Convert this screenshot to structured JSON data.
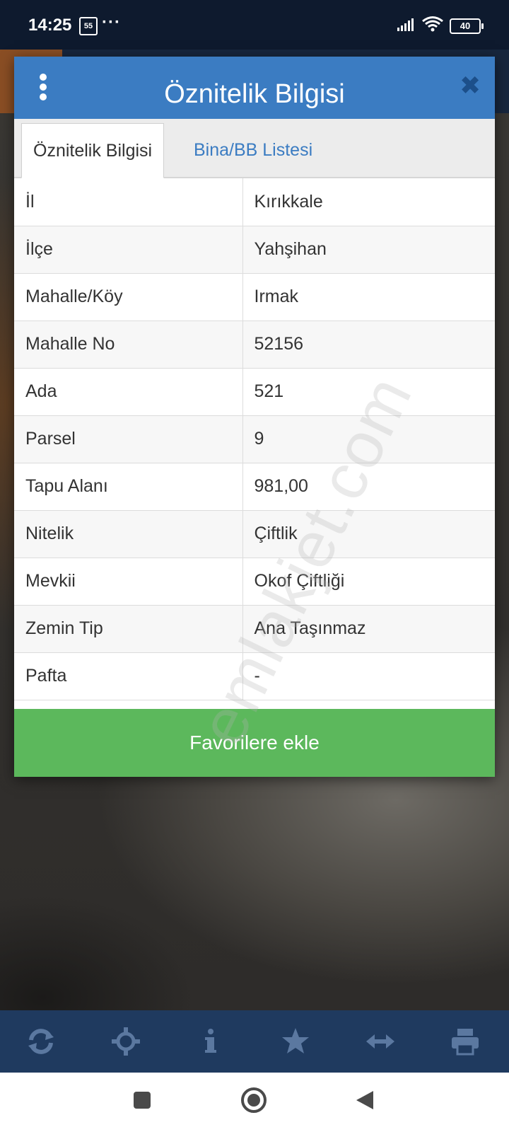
{
  "status_bar": {
    "time": "14:25",
    "notification_badge": "55",
    "more": "···",
    "battery": "40"
  },
  "dialog": {
    "title": "Öznitelik Bilgisi",
    "tabs": [
      {
        "label": "Öznitelik Bilgisi",
        "active": true
      },
      {
        "label": "Bina/BB Listesi",
        "active": false
      }
    ],
    "rows": [
      {
        "key": "İl",
        "value": "Kırıkkale"
      },
      {
        "key": "İlçe",
        "value": "Yahşihan"
      },
      {
        "key": "Mahalle/Köy",
        "value": "Irmak"
      },
      {
        "key": "Mahalle No",
        "value": "52156"
      },
      {
        "key": "Ada",
        "value": "521"
      },
      {
        "key": "Parsel",
        "value": "9"
      },
      {
        "key": "Tapu Alanı",
        "value": "981,00"
      },
      {
        "key": "Nitelik",
        "value": "Çiftlik"
      },
      {
        "key": "Mevkii",
        "value": "Okof Çiftliği"
      },
      {
        "key": "Zemin Tip",
        "value": "Ana Taşınmaz"
      },
      {
        "key": "Pafta",
        "value": "-"
      }
    ],
    "favorite_button": "Favorilere ekle"
  },
  "watermark": "emlakjet.com",
  "toolbar": {
    "icons": [
      "refresh-icon",
      "locate-icon",
      "info-icon",
      "star-icon",
      "measure-icon",
      "print-icon"
    ]
  },
  "colors": {
    "header_blue": "#3b7cc2",
    "toolbar_navy": "#1f3a5f",
    "favorite_green": "#5cb85c"
  }
}
